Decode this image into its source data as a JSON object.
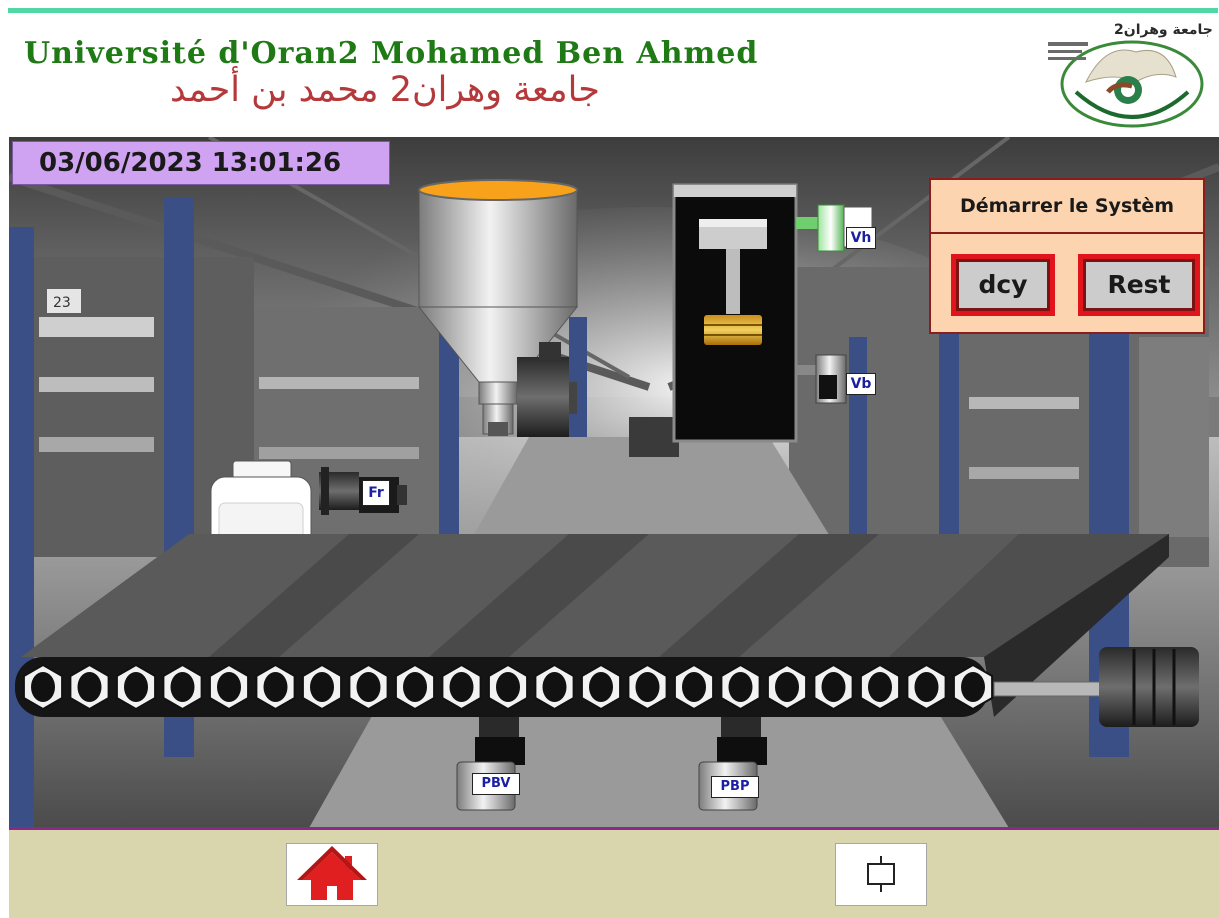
{
  "header": {
    "title_fr": "Université d'Oran2 Mohamed Ben Ahmed",
    "title_ar": "جامعة وهران2 محمد بن أحمد",
    "logo_text": "جامعة وهران2",
    "accent_color": "#4fd7a4",
    "title_fr_color": "#1f7a16",
    "title_ar_color": "#b5393a"
  },
  "status": {
    "datetime": "03/06/2023 13:01:26"
  },
  "control_panel": {
    "title": "Démarrer le Systèm",
    "start_button": "dcy",
    "reset_button": "Rest"
  },
  "devices": {
    "valve_top": "Vh",
    "valve_bottom": "Vb",
    "filler_valve": "Fr",
    "sensor_bottle": "PBV",
    "sensor_position": "PBP"
  },
  "footer": {
    "home_icon": "home-icon",
    "frame_icon": "frame-icon"
  }
}
